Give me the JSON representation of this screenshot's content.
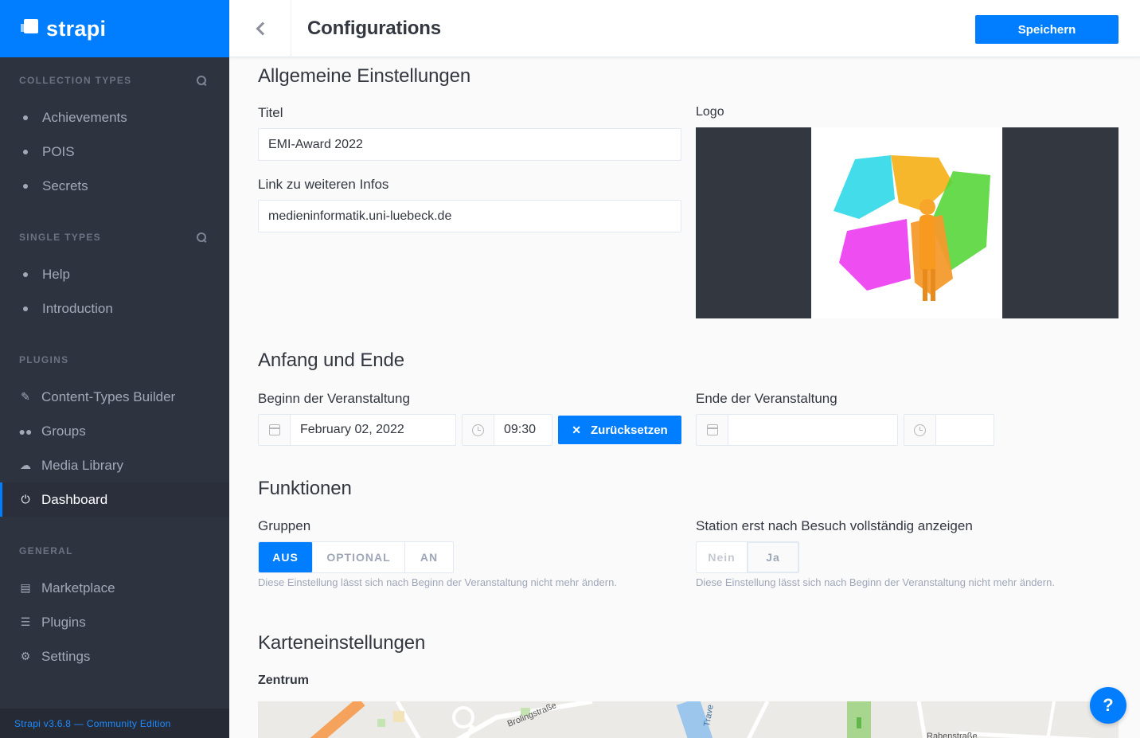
{
  "brand": {
    "name": "strapi"
  },
  "sidebar": {
    "collection_types": {
      "title": "Collection Types",
      "items": [
        "Achievements",
        "POIS",
        "Secrets"
      ]
    },
    "single_types": {
      "title": "Single Types",
      "items": [
        "Help",
        "Introduction"
      ]
    },
    "plugins": {
      "title": "Plugins",
      "items": [
        {
          "label": "Content-Types Builder",
          "icon": "brush-icon"
        },
        {
          "label": "Groups",
          "icon": "users-icon"
        },
        {
          "label": "Media Library",
          "icon": "cloud-icon"
        },
        {
          "label": "Dashboard",
          "icon": "plug-icon",
          "active": true
        }
      ]
    },
    "general": {
      "title": "General",
      "items": [
        {
          "label": "Marketplace",
          "icon": "shop-icon"
        },
        {
          "label": "Plugins",
          "icon": "list-icon"
        },
        {
          "label": "Settings",
          "icon": "gear-icon"
        }
      ]
    },
    "footer": "Strapi v3.6.8 — Community Edition"
  },
  "header": {
    "title": "Configurations",
    "save_label": "Speichern"
  },
  "general_settings": {
    "heading": "Allgemeine Einstellungen",
    "title_label": "Titel",
    "title_value": "EMI-Award 2022",
    "link_label": "Link zu weiteren Infos",
    "link_value": "medieninformatik.uni-luebeck.de",
    "logo_label": "Logo"
  },
  "schedule": {
    "heading": "Anfang und Ende",
    "start_label": "Beginn der Veranstaltung",
    "start_date": "February 02, 2022",
    "start_time": "09:30",
    "reset_label": "Zurücksetzen",
    "end_label": "Ende der Veranstaltung",
    "end_date": "",
    "end_time": ""
  },
  "functions": {
    "heading": "Funktionen",
    "groups_label": "Gruppen",
    "groups_options": [
      "AUS",
      "OPTIONAL",
      "AN"
    ],
    "groups_selected": "AUS",
    "groups_hint": "Diese Einstellung lässt sich nach Beginn der Veranstaltung nicht mehr ändern.",
    "station_label": "Station erst nach Besuch vollständig anzeigen",
    "station_options": [
      "Nein",
      "Ja"
    ],
    "station_selected": "Ja",
    "station_hint": "Diese Einstellung lässt sich nach Beginn der Veranstaltung nicht mehr ändern."
  },
  "map_settings": {
    "heading": "Karteneinstellungen",
    "center_label": "Zentrum",
    "street_labels": [
      "Brolingstraße",
      "Trave",
      "Rabenstraße"
    ]
  },
  "help": {
    "label": "?"
  },
  "colors": {
    "accent": "#007eff",
    "sidebar": "#2e3340"
  }
}
